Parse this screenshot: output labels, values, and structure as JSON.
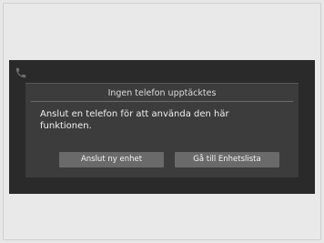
{
  "dialog": {
    "title": "Ingen telefon upptäcktes",
    "message": "Anslut en telefon för att använda den här funktionen.",
    "buttons": {
      "connect_new_device": "Anslut ny enhet",
      "go_to_device_list": "Gå till Enhetslista"
    }
  },
  "icons": {
    "phone": "phone-icon"
  }
}
